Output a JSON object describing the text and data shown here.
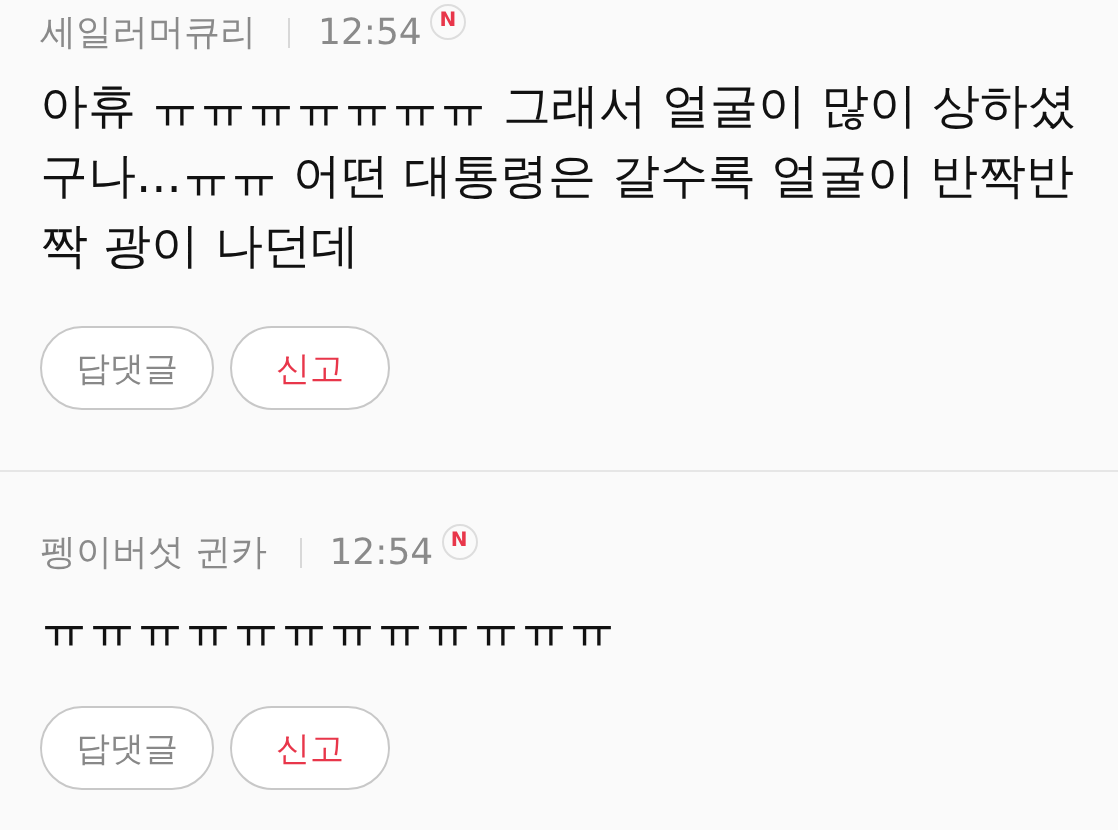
{
  "comments": [
    {
      "author": "세일러머큐리",
      "time": "12:54",
      "badge": "N",
      "body": "아휴 ㅠㅠㅠㅠㅠㅠㅠ 그래서 얼굴이 많이 상하셨구나...ㅠㅠ 어떤 대통령은 갈수록 얼굴이 반짝반짝 광이 나던데",
      "buttons": [
        {
          "label": "답댓글",
          "kind": "reply"
        },
        {
          "label": "신고",
          "kind": "report"
        }
      ]
    },
    {
      "author": "펭이버섯 귄카",
      "time": "12:54",
      "badge": "N",
      "body": "ㅠㅠㅠㅠㅠㅠㅠㅠㅠㅠㅠㅠ",
      "buttons": [
        {
          "label": "답댓글",
          "kind": "reply"
        },
        {
          "label": "신고",
          "kind": "report"
        }
      ]
    }
  ]
}
